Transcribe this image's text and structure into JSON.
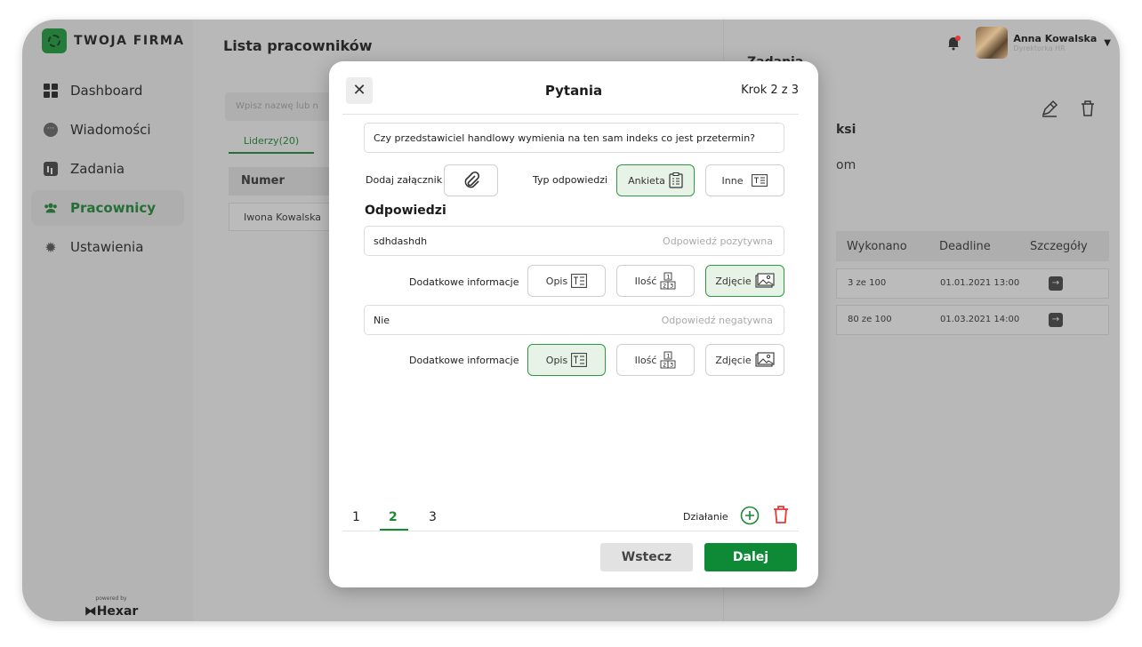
{
  "brand": {
    "name": "TWOJA FIRMA",
    "powered_by": "powered by",
    "vendor": "Hexar"
  },
  "sidebar": {
    "items": [
      {
        "label": "Dashboard",
        "icon": "dashboard-icon",
        "active": false
      },
      {
        "label": "Wiadomości",
        "icon": "messages-icon",
        "active": false
      },
      {
        "label": "Zadania",
        "icon": "tasks-icon",
        "active": false
      },
      {
        "label": "Pracownicy",
        "icon": "employees-icon",
        "active": true
      },
      {
        "label": "Ustawienia",
        "icon": "settings-icon",
        "active": false
      }
    ]
  },
  "main": {
    "title": "Lista pracowników",
    "search_placeholder": "Wpisz nazwę lub n",
    "tab": "Liderzy(20)",
    "column_numer": "Numer",
    "row_name": "Iwona Kowalska"
  },
  "right_panel": {
    "title_fragment": "Zadania",
    "frag_ksi": "ksi",
    "frag_om": "om",
    "columns": [
      "Wykonano",
      "Deadline",
      "Szczegóły"
    ],
    "rows": [
      {
        "done": "3 ze 100",
        "deadline": "01.01.2021  13:00"
      },
      {
        "done": "80 ze 100",
        "deadline": "01.03.2021  14:00"
      }
    ]
  },
  "user": {
    "name": "Anna Kowalska",
    "role": "Dyrektorka HR"
  },
  "modal": {
    "title": "Pytania",
    "step": "Krok 2 z 3",
    "question": "Czy przedstawiciel handlowy wymienia na ten sam indeks co jest przetermin?",
    "attach_label": "Dodaj załącznik",
    "answer_type_label": "Typ odpowiedzi",
    "type_options": [
      {
        "label": "Ankieta",
        "selected": true
      },
      {
        "label": "Inne",
        "selected": false
      }
    ],
    "answers_title": "Odpowiedzi",
    "answers": [
      {
        "value": "sdhdashdh",
        "hint": "Odpowiedź pozytywna",
        "extra_label": "Dodatkowe informacje",
        "options": [
          {
            "label": "Opis",
            "selected": false
          },
          {
            "label": "Ilość",
            "selected": false
          },
          {
            "label": "Zdjęcie",
            "selected": true
          }
        ]
      },
      {
        "value": "Nie",
        "hint": "Odpowiedź  negatywna",
        "extra_label": "Dodatkowe informacje",
        "options": [
          {
            "label": "Opis",
            "selected": true
          },
          {
            "label": "Ilość",
            "selected": false
          },
          {
            "label": "Zdjęcie",
            "selected": false
          }
        ]
      }
    ],
    "steps": [
      "1",
      "2",
      "3"
    ],
    "active_step": "2",
    "action_label": "Działanie",
    "back_label": "Wstecz",
    "next_label": "Dalej"
  },
  "colors": {
    "accent": "#1a8a34",
    "primary_button": "#0e8a37",
    "danger": "#e53935",
    "selected_bg": "#e6f3e6"
  }
}
